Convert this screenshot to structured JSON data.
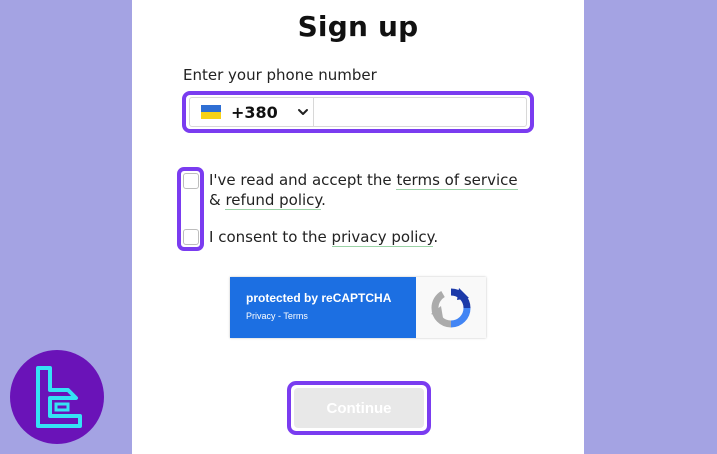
{
  "signup": {
    "title": "Sign up",
    "phone_label": "Enter your phone number",
    "country": {
      "flag_icon": "ukraine-flag-icon",
      "dial_code": "+380"
    },
    "phone_value": "",
    "terms": {
      "prefix": "I've read and accept the ",
      "terms_link": "terms of service",
      "amp": "& ",
      "refund_link": "refund policy",
      "suffix": "."
    },
    "privacy": {
      "prefix": "I consent to the ",
      "privacy_link": "privacy policy",
      "suffix": "."
    },
    "recaptcha": {
      "protected_text": "protected by reCAPTCHA",
      "privacy_link": "Privacy",
      "separator": " - ",
      "terms_link": "Terms"
    },
    "continue_label": "Continue"
  },
  "colors": {
    "background": "#a4a3e3",
    "highlight": "#7a3cf0",
    "recaptcha_blue": "#1c6fe2",
    "brand_logo": "#6a13b8"
  }
}
